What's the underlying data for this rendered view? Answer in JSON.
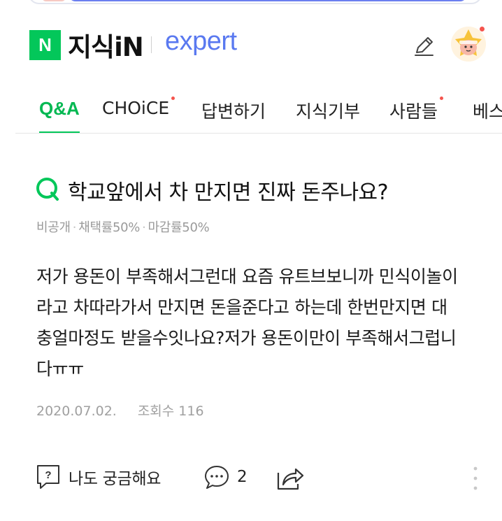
{
  "header": {
    "logo_letter": "N",
    "brand": "지식iN",
    "expert": "expert"
  },
  "tabs": [
    {
      "label": "Q&A",
      "active": true,
      "dot": false
    },
    {
      "label": "CHOiCE",
      "active": false,
      "dot": true
    },
    {
      "label": "답변하기",
      "active": false,
      "dot": false
    },
    {
      "label": "지식기부",
      "active": false,
      "dot": false
    },
    {
      "label": "사람들",
      "active": false,
      "dot": true
    },
    {
      "label": "베스",
      "active": false,
      "dot": false
    }
  ],
  "question": {
    "mark": "Q",
    "title": "학교앞에서 차 만지면 진짜 돈주나요?",
    "meta": {
      "privacy": "비공개",
      "adoption_rate": "채택률50%",
      "closing_rate": "마감률50%"
    },
    "body_lines": [
      "저가 용돈이 부족해서그런대 요즘 유트브보니까 민식이놀이",
      "라고 차따라가서 만지면 돈을준다고 하는데 한번만지면 대",
      "충얼마정도 받을수잇나요?저가 용돈이만이 부족해서그럽니",
      "다ㅠㅠ"
    ],
    "date": "2020.07.02.",
    "views": "조회수 116"
  },
  "actions": {
    "curious_label": "나도 궁금해요",
    "comment_count": "2"
  },
  "colors": {
    "naver_green": "#03c75a",
    "expert_blue": "#5a79f0",
    "notice_dot": "#f5544d"
  }
}
